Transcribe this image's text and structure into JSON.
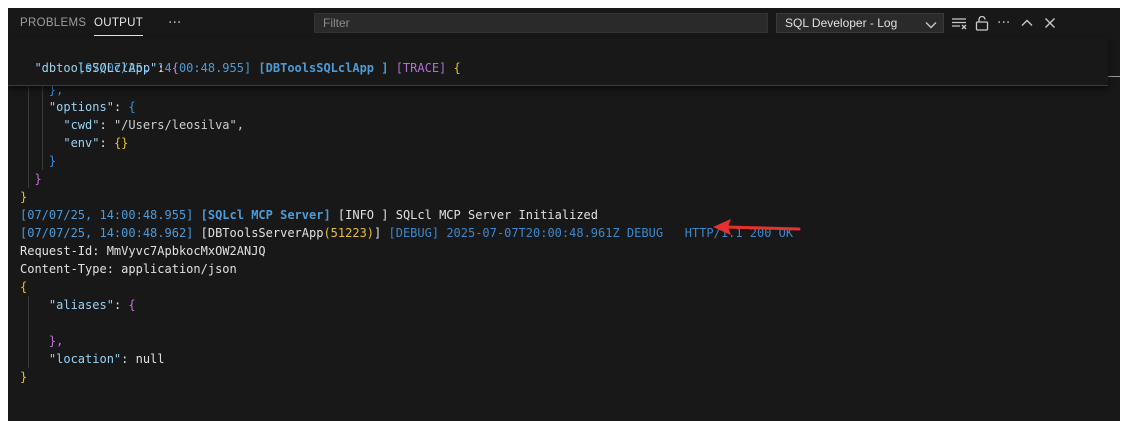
{
  "tabs": [
    {
      "label": "PROBLEMS",
      "active": false
    },
    {
      "label": "OUTPUT",
      "active": true
    }
  ],
  "tab_more": "···",
  "filter": {
    "placeholder": "Filter",
    "value": ""
  },
  "channel_select": {
    "value": "SQL Developer - Log"
  },
  "toolbar_more": "···",
  "colors": {
    "panel_bg": "#181818",
    "timestamp": "#4d9bd6",
    "trace": "#b36fd4",
    "brace": "#e5c22a",
    "arrow": "#e8312f"
  },
  "log": {
    "sticky1": {
      "ts": "[07/07/25, 14:00:48.955]",
      "app": "[DBToolsSQLclApp ]",
      "level": "[TRACE]",
      "brace": "{"
    },
    "sticky2": {
      "key": "\"dbtoolsSQLclApp\"",
      "colon": ": ",
      "brace": "{"
    },
    "l_partial": "},",
    "l_options_key": "\"options\"",
    "l_options_brace": "{",
    "l_cwd_key": "\"cwd\"",
    "l_cwd_val": "\"/Users/leosilva\",",
    "l_env_key": "\"env\"",
    "l_env_val": "{}",
    "l_close1": "}",
    "l_close2": "}",
    "l_close3": "}",
    "info": {
      "ts": "[07/07/25, 14:00:48.955]",
      "app": "[SQLcl MCP Server]",
      "level": "[INFO ]",
      "msg": "SQLcl MCP Server Initialized"
    },
    "debug": {
      "ts": "[07/07/25, 14:00:48.962]",
      "app_open": "[DBToolsServerApp",
      "pid": "(51223)",
      "app_close": "]",
      "level": "[DEBUG]",
      "msg": "2025-07-07T20:00:48.961Z DEBUG",
      "http": "HTTP/1.1 200 OK"
    },
    "req_id": "Request-Id: MmVyvc7ApbkocMxOW2ANJQ",
    "content_type": "Content-Type: application/json",
    "open_brace": "{",
    "aliases_key": "\"aliases\"",
    "aliases_brace": "{",
    "aliases_close": "},",
    "location_key": "\"location\"",
    "location_val": "null",
    "final_close": "}"
  }
}
